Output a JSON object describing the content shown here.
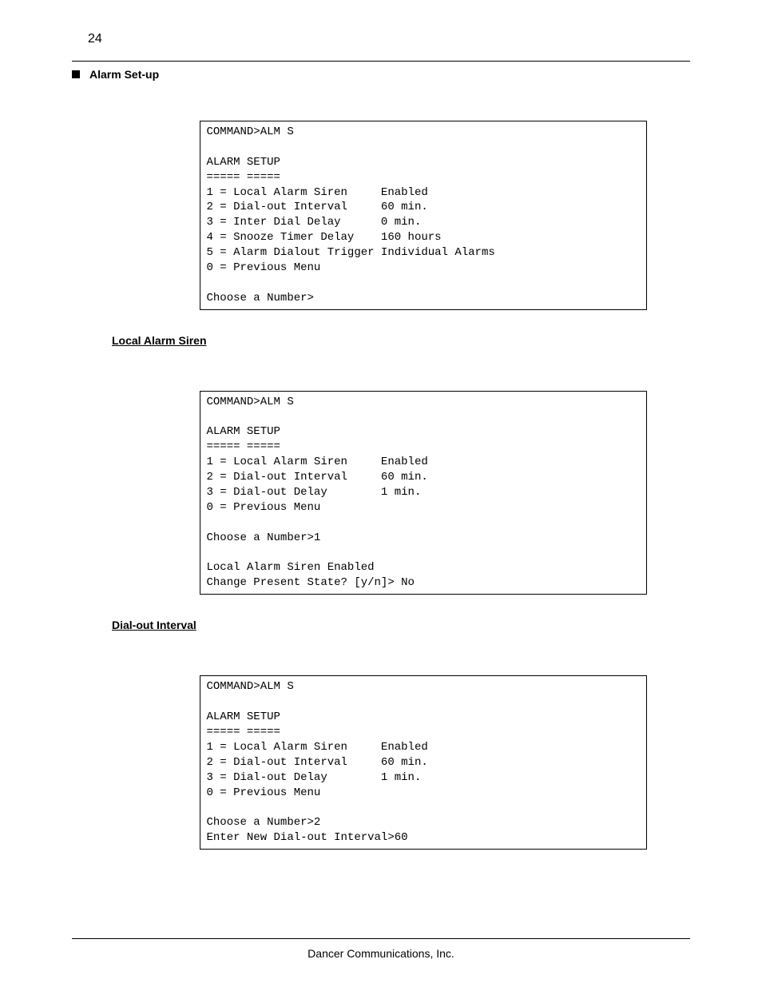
{
  "page_number": "24",
  "section_title": "Alarm Set-up",
  "code_block_1": "COMMAND>ALM S\n\nALARM SETUP\n===== =====\n1 = Local Alarm Siren     Enabled\n2 = Dial-out Interval     60 min.\n3 = Inter Dial Delay      0 min.\n4 = Snooze Timer Delay    160 hours\n5 = Alarm Dialout Trigger Individual Alarms\n0 = Previous Menu\n\nChoose a Number>",
  "sub_heading_1": "Local Alarm Siren",
  "code_block_2": "COMMAND>ALM S\n\nALARM SETUP\n===== =====\n1 = Local Alarm Siren     Enabled\n2 = Dial-out Interval     60 min.\n3 = Dial-out Delay        1 min.\n0 = Previous Menu\n\nChoose a Number>1\n\nLocal Alarm Siren Enabled\nChange Present State? [y/n]> No\n",
  "sub_heading_2": "Dial-out Interval",
  "code_block_3": "COMMAND>ALM S\n\nALARM SETUP\n===== =====\n1 = Local Alarm Siren     Enabled\n2 = Dial-out Interval     60 min.\n3 = Dial-out Delay        1 min.\n0 = Previous Menu\n\nChoose a Number>2\nEnter New Dial-out Interval>60",
  "footer": "Dancer Communications, Inc."
}
